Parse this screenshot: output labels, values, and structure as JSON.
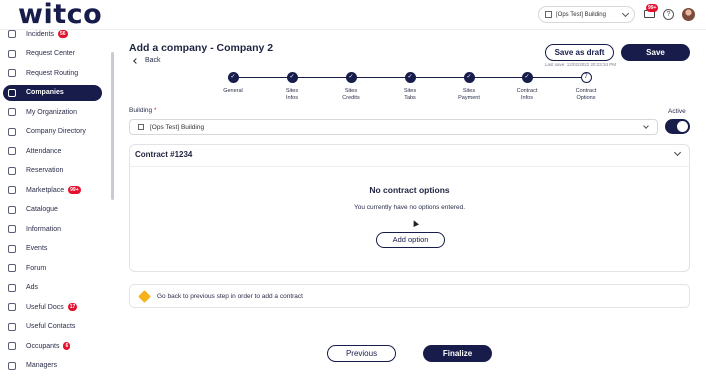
{
  "header": {
    "logo": "witco",
    "building_selector": "[Ops Test] Building",
    "mail_badge": "99+",
    "help_label": "?",
    "icons": [
      "building-icon",
      "chevron-down-icon",
      "mail-icon",
      "help-icon",
      "avatar"
    ]
  },
  "sidebar": {
    "items": [
      {
        "label": "Incidents",
        "badge": "56",
        "icon": "warning-icon",
        "active": false
      },
      {
        "label": "Request Center",
        "badge": "",
        "icon": "inbox-icon",
        "active": false
      },
      {
        "label": "Request Routing",
        "badge": "",
        "icon": "routing-icon",
        "active": false
      },
      {
        "label": "Companies",
        "badge": "",
        "icon": "building-icon",
        "active": true
      },
      {
        "label": "My Organization",
        "badge": "",
        "icon": "organization-icon",
        "active": false
      },
      {
        "label": "Company Directory",
        "badge": "",
        "icon": "directory-icon",
        "active": false
      },
      {
        "label": "Attendance",
        "badge": "",
        "icon": "check-circle-icon",
        "active": false
      },
      {
        "label": "Reservation",
        "badge": "",
        "icon": "calendar-icon",
        "active": false
      },
      {
        "label": "Marketplace",
        "badge": "99+",
        "icon": "store-icon",
        "active": false
      },
      {
        "label": "Catalogue",
        "badge": "",
        "icon": "book-icon",
        "active": false
      },
      {
        "label": "Information",
        "badge": "",
        "icon": "info-icon",
        "active": false
      },
      {
        "label": "Events",
        "badge": "",
        "icon": "event-icon",
        "active": false
      },
      {
        "label": "Forum",
        "badge": "",
        "icon": "chat-icon",
        "active": false
      },
      {
        "label": "Ads",
        "badge": "",
        "icon": "tag-icon",
        "active": false
      },
      {
        "label": "Useful Docs",
        "badge": "17",
        "icon": "document-icon",
        "active": false
      },
      {
        "label": "Useful Contacts",
        "badge": "",
        "icon": "contacts-icon",
        "active": false
      },
      {
        "label": "Occupants",
        "badge": "6",
        "icon": "people-icon",
        "active": false
      },
      {
        "label": "Managers",
        "badge": "",
        "icon": "person-icon",
        "active": false
      }
    ]
  },
  "page": {
    "title": "Add a company - Company 2",
    "back_label": "Back",
    "save_draft_label": "Save as draft",
    "save_label": "Save",
    "last_save": "Last save: 12/02/2022 20:23:34 PM"
  },
  "stepper": {
    "steps": [
      {
        "line1": "General",
        "line2": "",
        "done": true
      },
      {
        "line1": "Sites",
        "line2": "Infos",
        "done": true
      },
      {
        "line1": "Sites",
        "line2": "Credits",
        "done": true
      },
      {
        "line1": "Sites",
        "line2": "Tabs",
        "done": true
      },
      {
        "line1": "Sites",
        "line2": "Payment",
        "done": true
      },
      {
        "line1": "Contract",
        "line2": "Infos",
        "done": true
      },
      {
        "line1": "Contract",
        "line2": "Options",
        "done": false,
        "number": "7"
      }
    ],
    "check_glyph": "✓"
  },
  "building_field": {
    "label": "Building",
    "required_mark": "*",
    "value": "[Ops Test] Building",
    "active_label": "Active",
    "active": true
  },
  "contract": {
    "title": "Contract #1234",
    "empty_title": "No contract options",
    "empty_text": "You currently have no options entered.",
    "add_option_label": "Add option"
  },
  "info": {
    "message": "Go back to previous step in order to add a contract"
  },
  "footer": {
    "previous_label": "Previous",
    "finalize_label": "Finalize"
  },
  "colors": {
    "brand": "#171c4b",
    "badge": "#e3112d",
    "warning": "#f5b21b"
  }
}
